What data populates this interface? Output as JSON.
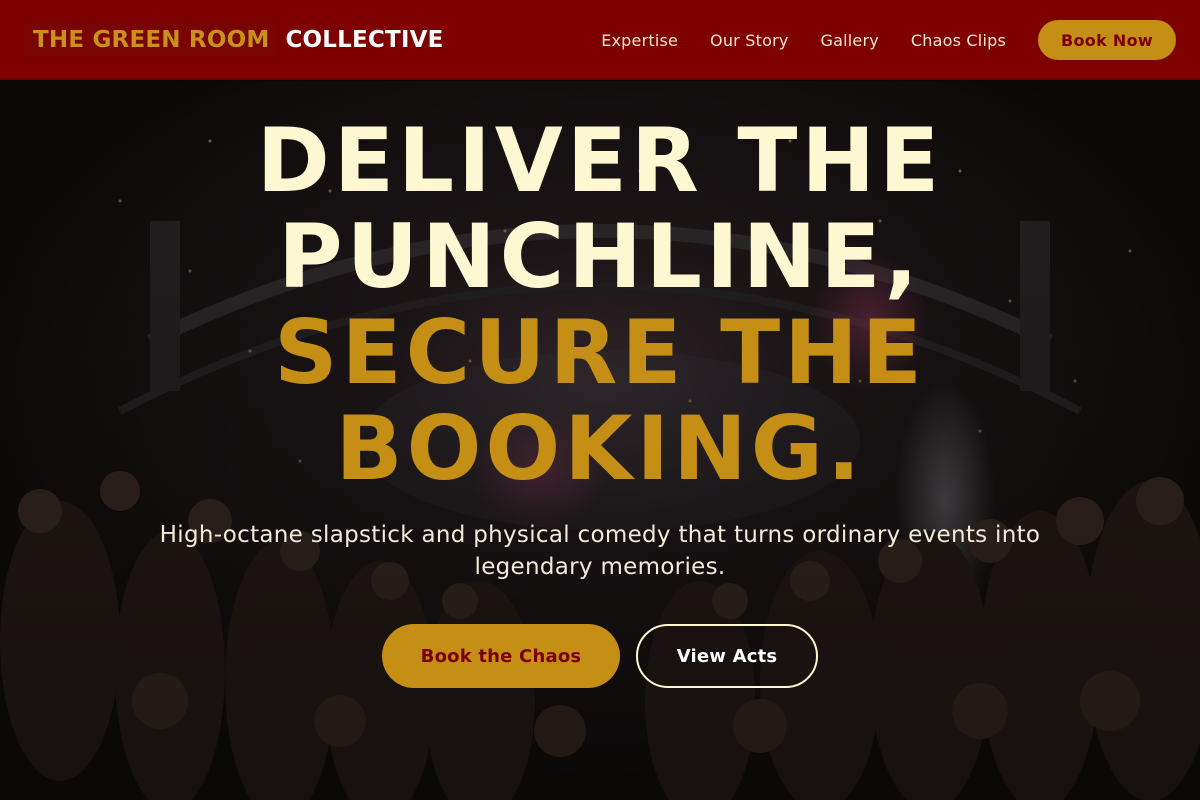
{
  "brand": {
    "name_highlight": "THE GREEN ROOM",
    "name_rest": "COLLECTIVE"
  },
  "nav": {
    "items": [
      {
        "label": "Expertise"
      },
      {
        "label": "Our Story"
      },
      {
        "label": "Gallery"
      },
      {
        "label": "Chaos Clips"
      }
    ],
    "cta_label": "Book Now"
  },
  "hero": {
    "headline_line1": "DELIVER THE",
    "headline_line2": "PUNCHLINE,",
    "headline_line3": "SECURE THE",
    "headline_line4": "BOOKING.",
    "subtitle": "High-octane slapstick and physical comedy that turns ordinary events into legendary memories.",
    "primary_button": "Book the Chaos",
    "secondary_button": "View Acts",
    "background_image": "concert-crowd-confetti-photo"
  },
  "colors": {
    "header_bg": "#7f0000",
    "accent_gold": "#c58e14",
    "cream": "#fdf8d2",
    "dark_red_text": "#7a0000"
  }
}
